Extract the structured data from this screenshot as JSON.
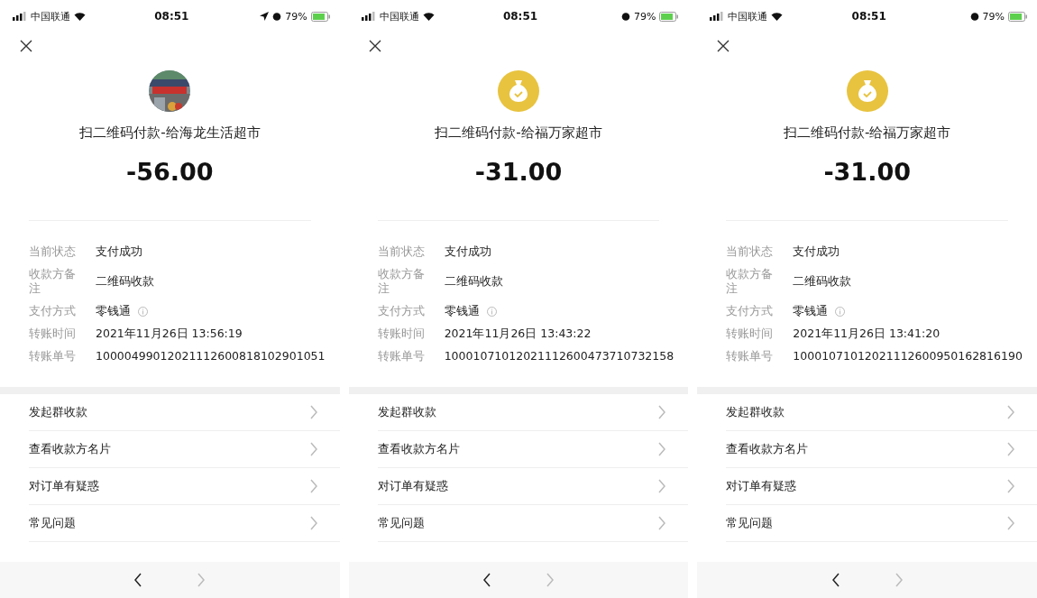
{
  "screens": [
    {
      "status_bar": {
        "carrier": "中国联通",
        "time": "08:51",
        "location": true,
        "battery": "79%"
      },
      "avatar": {
        "kind": "picture"
      },
      "title": "扫二维码付款-给海龙生活超市",
      "amount": "-56.00",
      "details": [
        {
          "label": "当前状态",
          "value": "支付成功",
          "info": false
        },
        {
          "label": "收款方备注",
          "value": "二维码收款",
          "info": false
        },
        {
          "label": "支付方式",
          "value": "零钱通",
          "info": true
        },
        {
          "label": "转账时间",
          "value": "2021年11月26日 13:56:19",
          "info": false
        },
        {
          "label": "转账单号",
          "value": "10000499012021112600818102901051",
          "info": false
        }
      ],
      "menu": [
        "发起群收款",
        "查看收款方名片",
        "对订单有疑惑",
        "常见问题"
      ],
      "nav": {
        "back_disabled": false,
        "forward_disabled": true
      }
    },
    {
      "status_bar": {
        "carrier": "中国联通",
        "time": "08:51",
        "location": false,
        "battery": "79%"
      },
      "avatar": {
        "kind": "money-bag"
      },
      "title": "扫二维码付款-给福万家超市",
      "amount": "-31.00",
      "details": [
        {
          "label": "当前状态",
          "value": "支付成功",
          "info": false
        },
        {
          "label": "收款方备注",
          "value": "二维码收款",
          "info": false
        },
        {
          "label": "支付方式",
          "value": "零钱通",
          "info": true
        },
        {
          "label": "转账时间",
          "value": "2021年11月26日 13:43:22",
          "info": false
        },
        {
          "label": "转账单号",
          "value": "10001071012021112600473710732158",
          "info": false
        }
      ],
      "menu": [
        "发起群收款",
        "查看收款方名片",
        "对订单有疑惑",
        "常见问题"
      ],
      "nav": {
        "back_disabled": false,
        "forward_disabled": true
      }
    },
    {
      "status_bar": {
        "carrier": "中国联通",
        "time": "08:51",
        "location": false,
        "battery": "79%"
      },
      "avatar": {
        "kind": "money-bag"
      },
      "title": "扫二维码付款-给福万家超市",
      "amount": "-31.00",
      "details": [
        {
          "label": "当前状态",
          "value": "支付成功",
          "info": false
        },
        {
          "label": "收款方备注",
          "value": "二维码收款",
          "info": false
        },
        {
          "label": "支付方式",
          "value": "零钱通",
          "info": true
        },
        {
          "label": "转账时间",
          "value": "2021年11月26日 13:41:20",
          "info": false
        },
        {
          "label": "转账单号",
          "value": "10001071012021112600950162816190",
          "info": false
        }
      ],
      "menu": [
        "发起群收款",
        "查看收款方名片",
        "对订单有疑惑",
        "常见问题"
      ],
      "nav": {
        "back_disabled": false,
        "forward_disabled": true
      }
    }
  ]
}
